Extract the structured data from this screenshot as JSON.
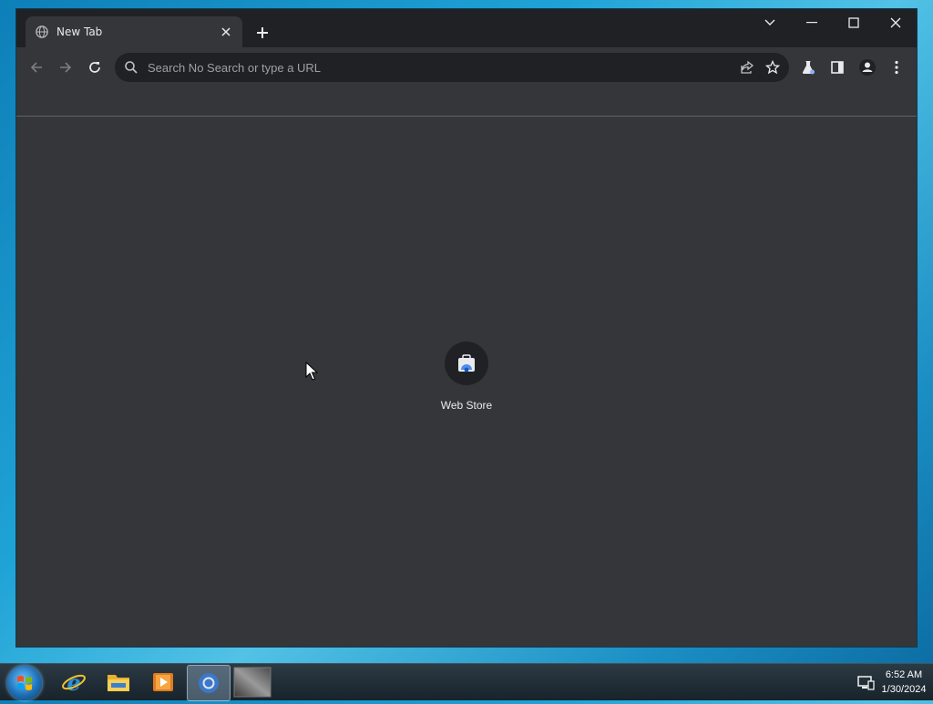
{
  "browser": {
    "tab": {
      "title": "New Tab",
      "favicon": "globe-icon"
    },
    "window_controls": [
      "tab-search-icon",
      "minimize-icon",
      "maximize-icon",
      "close-icon"
    ]
  },
  "toolbar": {
    "address_placeholder": "Search No Search or type a URL",
    "address_value": ""
  },
  "new_tab_page": {
    "shortcuts": [
      {
        "label": "Web Store",
        "icon": "web-store-icon"
      }
    ]
  },
  "taskbar": {
    "apps": [
      "internet-explorer-icon",
      "file-explorer-icon",
      "media-player-icon",
      "chrome-icon",
      "app-thumbnail-icon"
    ],
    "clock_time": "6:52 AM",
    "clock_date": "1/30/2024"
  },
  "colors": {
    "frame": "#202124",
    "toolbar": "#35363a",
    "text": "#e8eaed"
  }
}
